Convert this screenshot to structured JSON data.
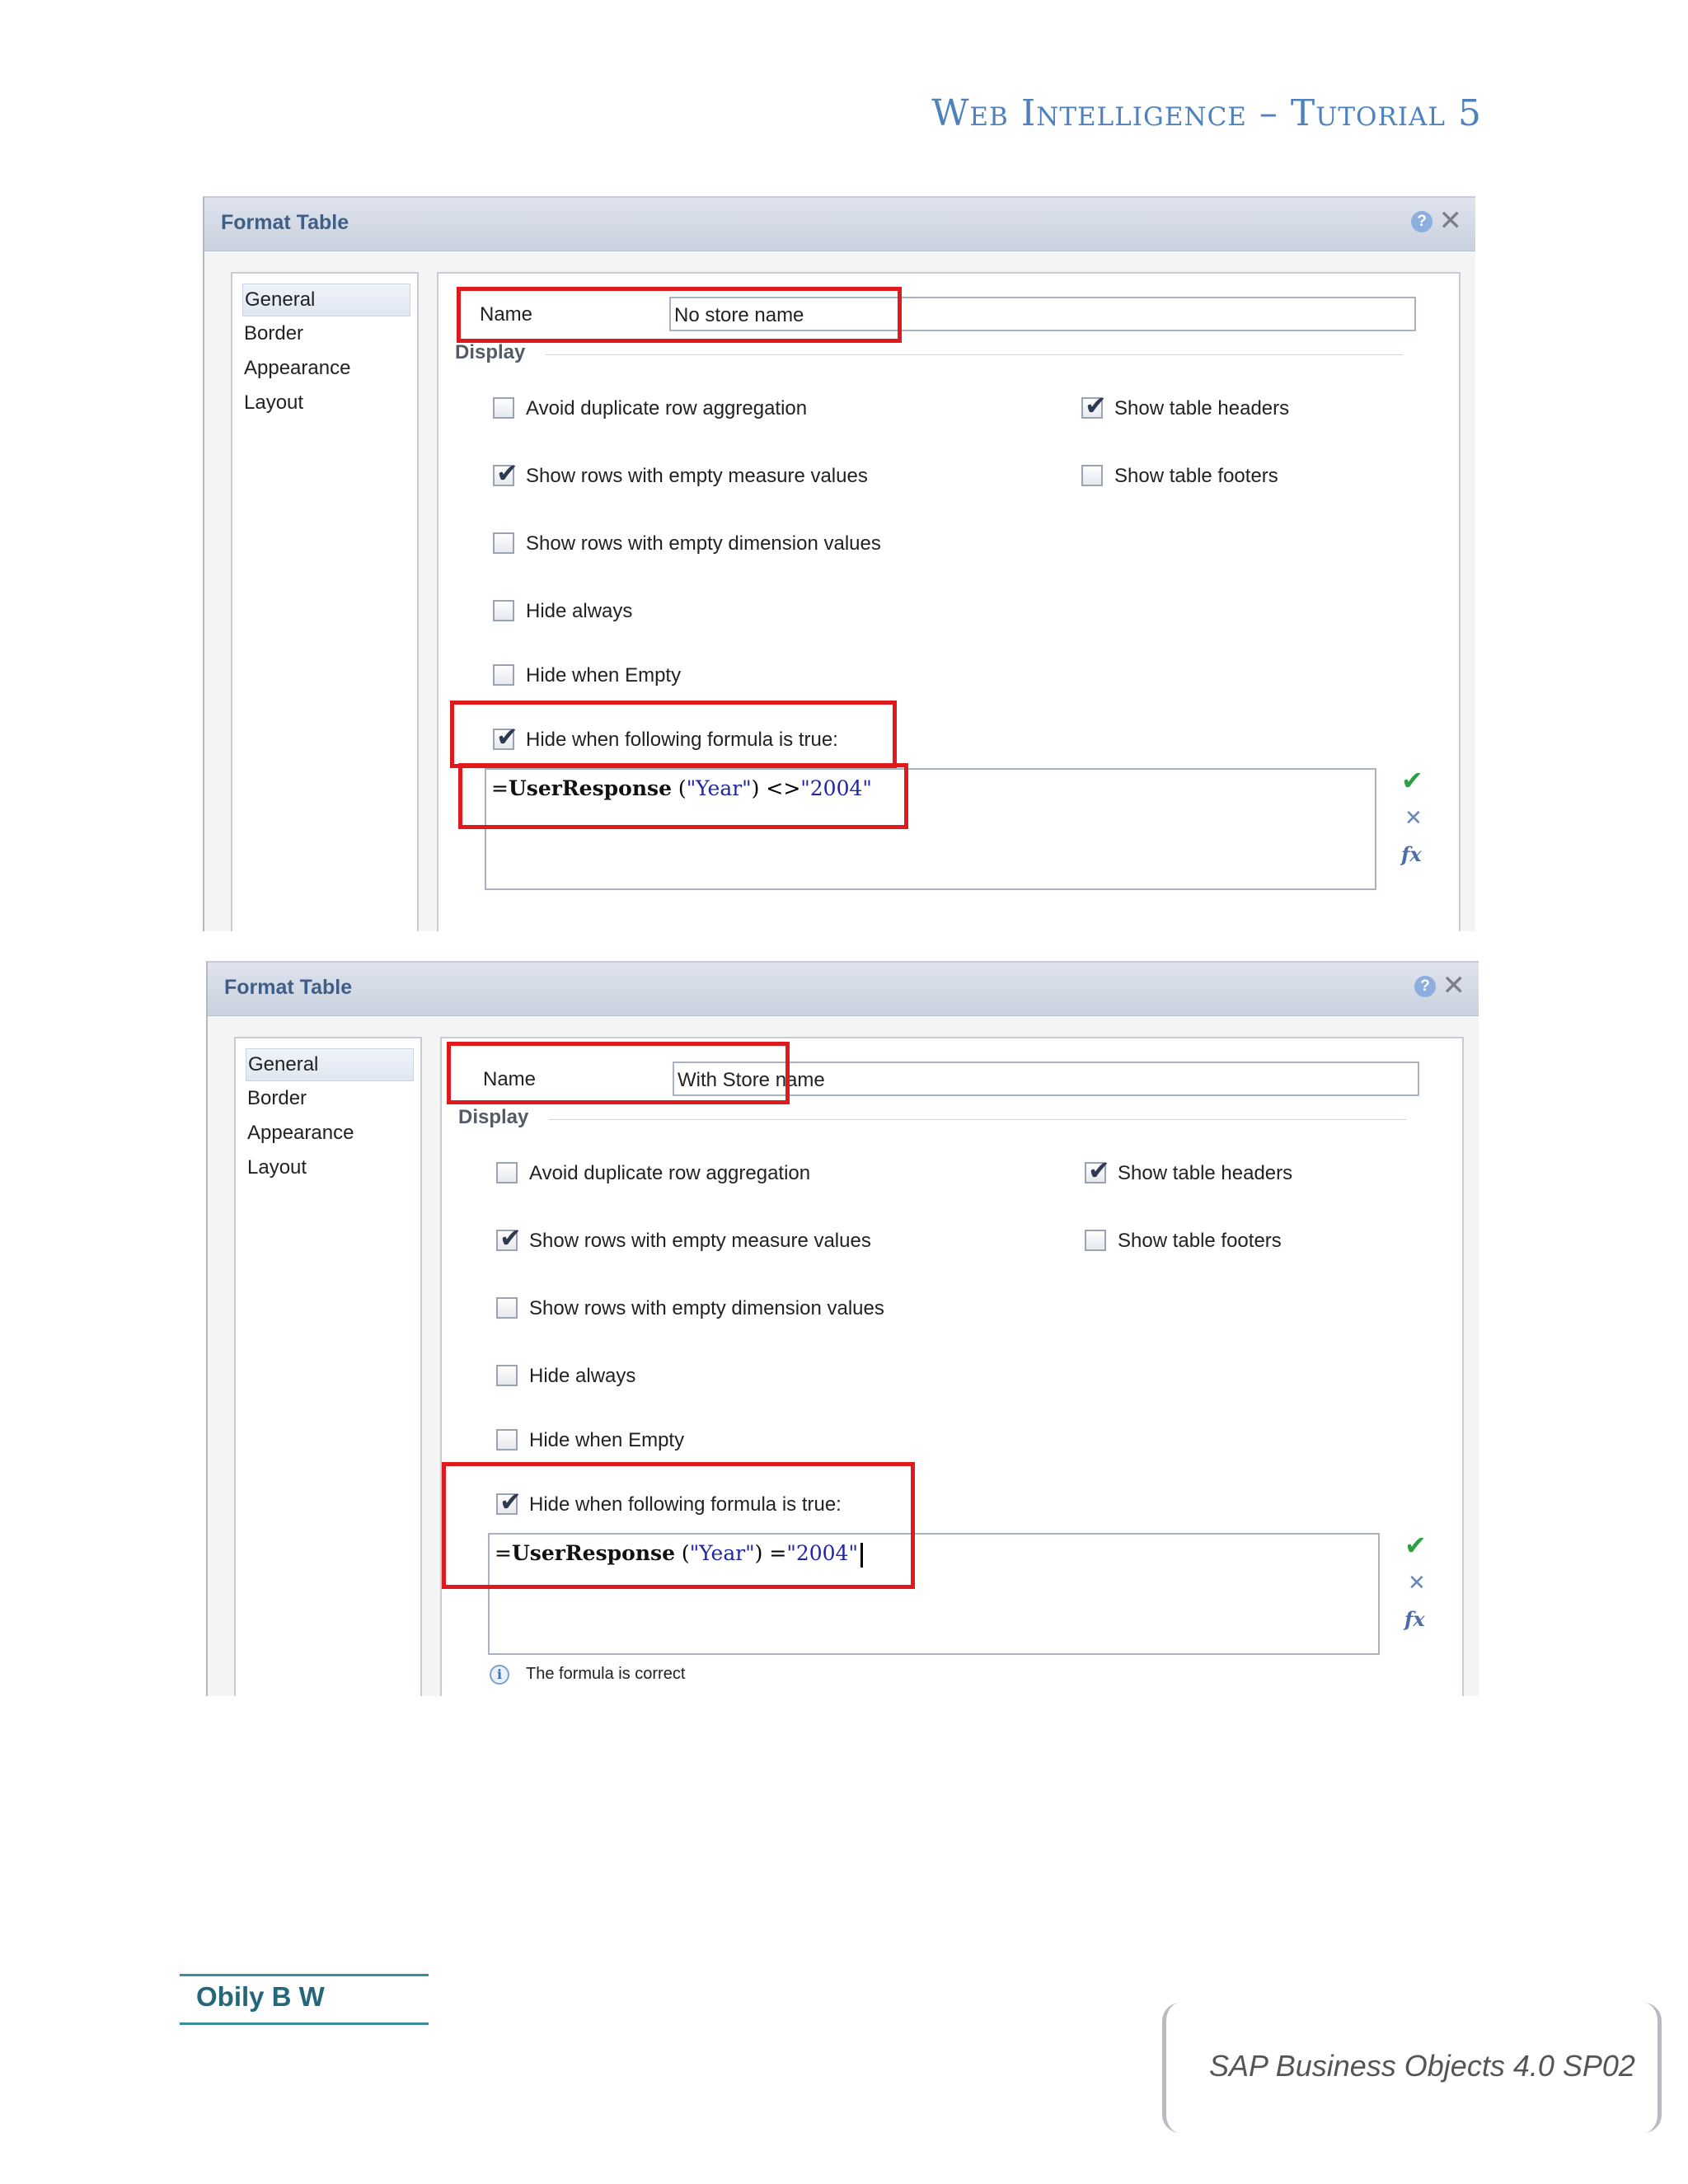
{
  "header": {
    "title": "Web Intelligence – Tutorial 5"
  },
  "dialogs": [
    {
      "title": "Format Table",
      "nav": [
        "General",
        "Border",
        "Appearance",
        "Layout"
      ],
      "name_label": "Name",
      "name_value": "No store name",
      "display_label": "Display",
      "checkboxes": [
        {
          "label": "Avoid duplicate row aggregation",
          "checked": false
        },
        {
          "label": "Show table headers",
          "checked": true
        },
        {
          "label": "Show rows with empty measure values",
          "checked": true
        },
        {
          "label": "Show table footers",
          "checked": false
        },
        {
          "label": "Show rows with empty dimension values",
          "checked": false
        },
        {
          "label": "Hide always",
          "checked": false
        },
        {
          "label": "Hide when Empty",
          "checked": false
        },
        {
          "label": "Hide when following formula is true:",
          "checked": true
        }
      ],
      "formula": {
        "prefix": "=",
        "fn": "UserResponse",
        "open": " (",
        "arg": "\"Year\"",
        "close": ") ",
        "op": "<>",
        "value": "\"2004\""
      },
      "info": ""
    },
    {
      "title": "Format Table",
      "nav": [
        "General",
        "Border",
        "Appearance",
        "Layout"
      ],
      "name_label": "Name",
      "name_value": "With Store name",
      "display_label": "Display",
      "checkboxes": [
        {
          "label": "Avoid duplicate row aggregation",
          "checked": false
        },
        {
          "label": "Show table headers",
          "checked": true
        },
        {
          "label": "Show rows with empty measure values",
          "checked": true
        },
        {
          "label": "Show table footers",
          "checked": false
        },
        {
          "label": "Show rows with empty dimension values",
          "checked": false
        },
        {
          "label": "Hide always",
          "checked": false
        },
        {
          "label": "Hide when Empty",
          "checked": false
        },
        {
          "label": "Hide when following formula is true:",
          "checked": true
        }
      ],
      "formula": {
        "prefix": "=",
        "fn": "UserResponse",
        "open": " (",
        "arg": "\"Year\"",
        "close": ") ",
        "op": "=",
        "value": "\"2004\""
      },
      "info": "The formula is correct"
    }
  ],
  "icons": {
    "help": "?",
    "close": "✕",
    "check": "✔",
    "validate": "✔",
    "cancel": "✕",
    "fx": "fx",
    "info": "i"
  },
  "footer": {
    "author": "Obily B W",
    "product": "SAP Business Objects 4.0 SP02"
  }
}
